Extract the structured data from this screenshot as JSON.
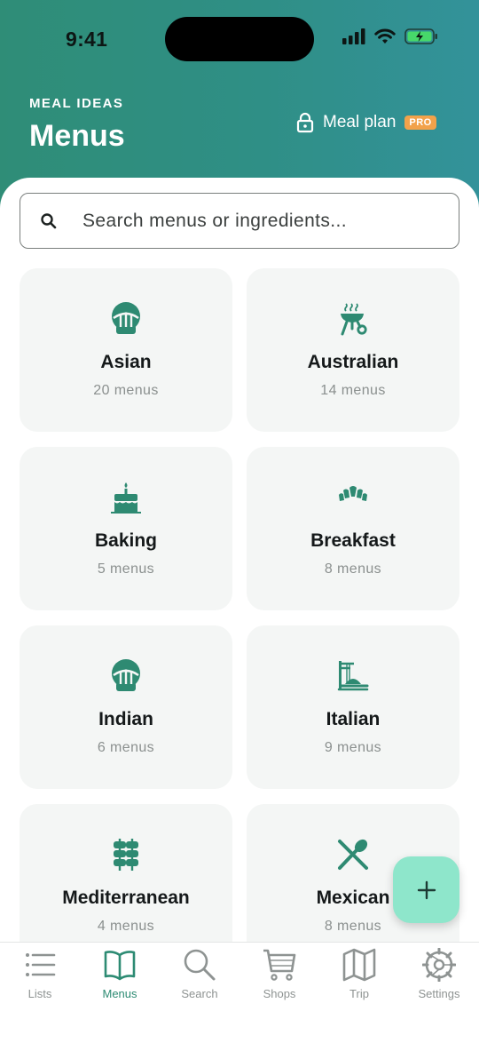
{
  "status_bar": {
    "time": "9:41"
  },
  "header": {
    "eyebrow": "MEAL IDEAS",
    "title": "Menus",
    "meal_plan_label": "Meal plan",
    "pro_badge": "PRO"
  },
  "search": {
    "placeholder": "Search menus or ingredients..."
  },
  "categories": [
    {
      "name": "Asian",
      "count": "20 menus",
      "icon": "bowl-icon"
    },
    {
      "name": "Australian",
      "count": "14 menus",
      "icon": "grill-icon"
    },
    {
      "name": "Baking",
      "count": "5 menus",
      "icon": "cake-icon"
    },
    {
      "name": "Breakfast",
      "count": "8 menus",
      "icon": "croissant-icon"
    },
    {
      "name": "Indian",
      "count": "6 menus",
      "icon": "bowl-icon"
    },
    {
      "name": "Italian",
      "count": "9 menus",
      "icon": "pasta-icon"
    },
    {
      "name": "Mediterranean",
      "count": "4 menus",
      "icon": "kebab-icon"
    },
    {
      "name": "Mexican",
      "count": "8 menus",
      "icon": "utensils-icon"
    }
  ],
  "tabs": [
    {
      "label": "Lists",
      "icon": "list-icon",
      "active": false
    },
    {
      "label": "Menus",
      "icon": "book-icon",
      "active": true
    },
    {
      "label": "Search",
      "icon": "search-icon",
      "active": false
    },
    {
      "label": "Shops",
      "icon": "cart-icon",
      "active": false
    },
    {
      "label": "Trip",
      "icon": "map-icon",
      "active": false
    },
    {
      "label": "Settings",
      "icon": "gear-icon",
      "active": false
    }
  ],
  "colors": {
    "header_start": "#2f8d77",
    "header_end": "#33929a",
    "accent": "#2d8b73",
    "fab": "#8ee6cb",
    "pro_badge": "#f2a24b"
  }
}
